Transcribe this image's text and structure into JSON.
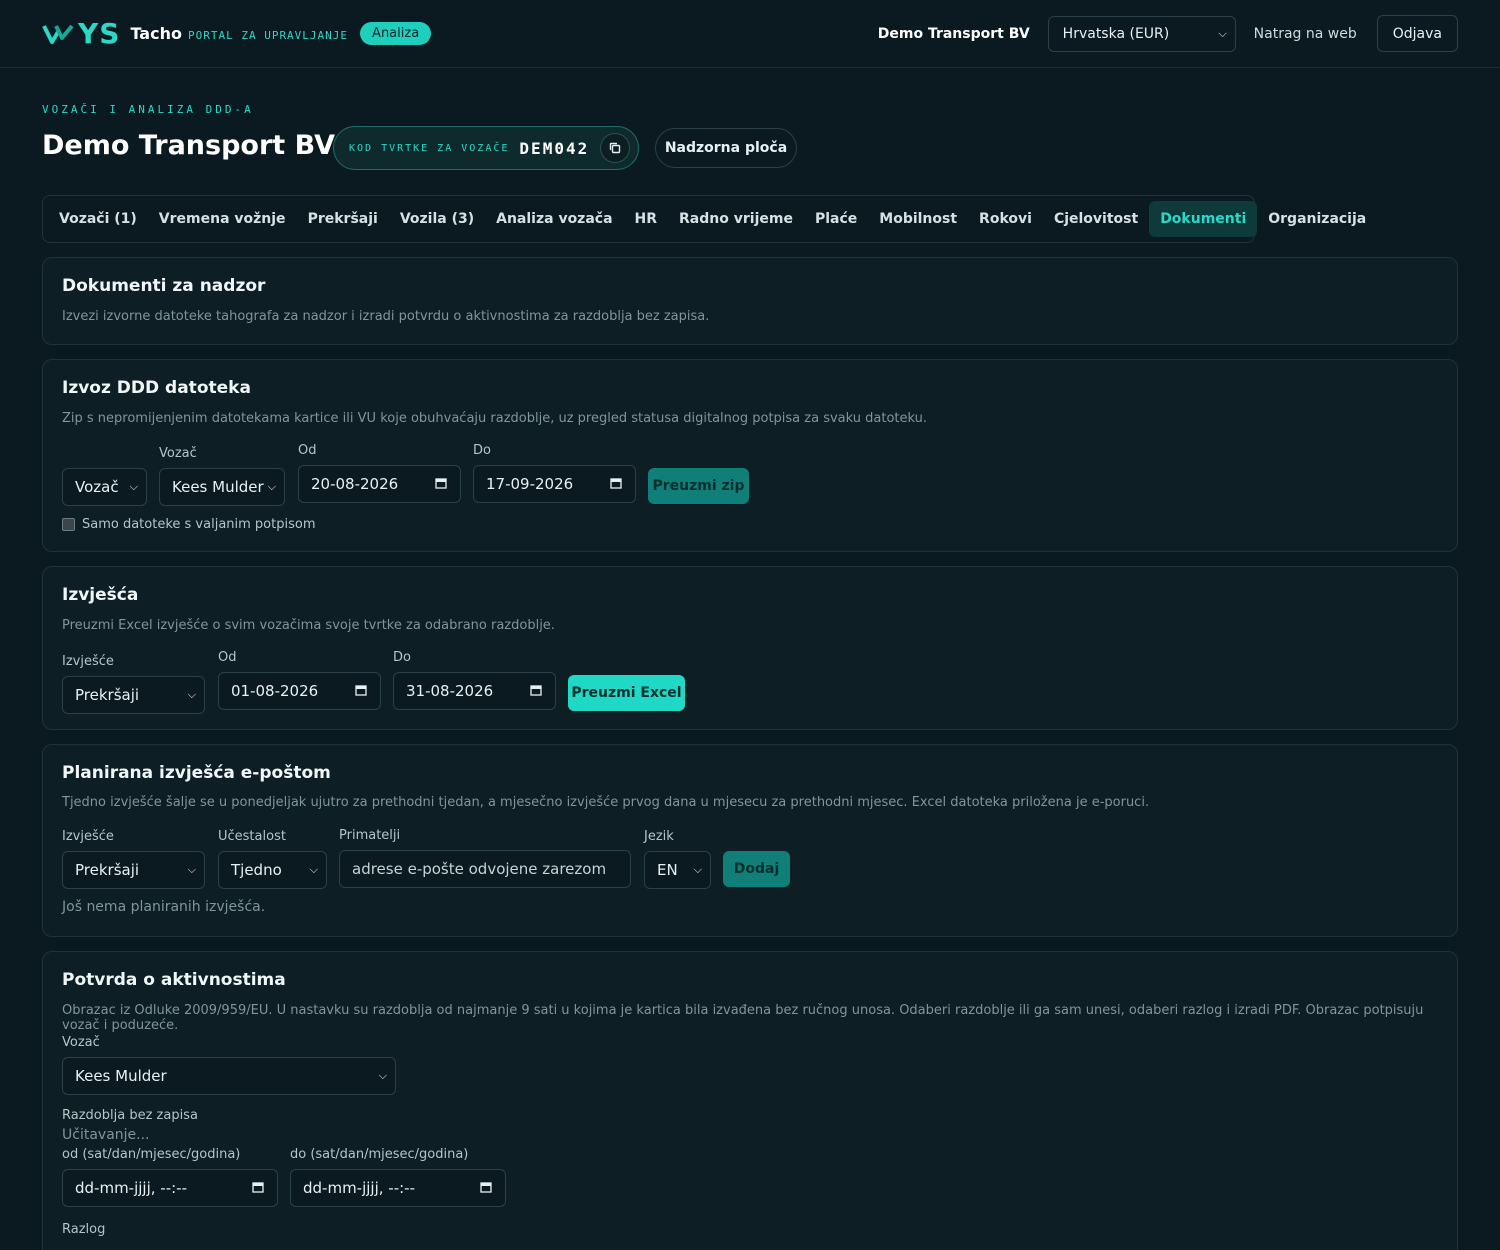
{
  "topbar": {
    "brand_ys": "YS",
    "brand_tacho": "Tacho",
    "brand_portal": "PORTAL ZA UPRAVLJANJE",
    "badge": "Analiza",
    "company": "Demo Transport BV",
    "region": "Hrvatska (EUR)",
    "back_link": "Natrag na web",
    "logout": "Odjava"
  },
  "header": {
    "eyebrow": "VOZAČI I ANALIZA DDD-A",
    "title": "Demo Transport BV",
    "code_label": "KOD TVRTKE ZA VOZAČE",
    "code_value": "DEM042",
    "dashboard_button": "Nadzorna ploča"
  },
  "tabs": [
    {
      "label": "Vozači (1)"
    },
    {
      "label": "Vremena vožnje"
    },
    {
      "label": "Prekršaji"
    },
    {
      "label": "Vozila (3)"
    },
    {
      "label": "Analiza vozača"
    },
    {
      "label": "HR"
    },
    {
      "label": "Radno vrijeme"
    },
    {
      "label": "Plaće"
    },
    {
      "label": "Mobilnost"
    },
    {
      "label": "Rokovi"
    },
    {
      "label": "Cjelovitost"
    },
    {
      "label": "Dokumenti",
      "active": true
    },
    {
      "label": "Organizacija"
    }
  ],
  "supervision": {
    "title": "Dokumenti za nadzor",
    "desc": "Izvezi izvorne datoteke tahografa za nadzor i izradi potvrdu o aktivnostima za razdoblja bez zapisa."
  },
  "ddd_export": {
    "title": "Izvoz DDD datoteka",
    "desc": "Zip s nepromijenjenim datotekama kartice ili VU koje obuhvaćaju razdoblje, uz pregled statusa digitalnog potpisa za svaku datoteku.",
    "type_select": "Vozač",
    "driver_label": "Vozač",
    "driver_select": "Kees Mulder",
    "from_label": "Od",
    "from_value": "20-08-2026",
    "to_label": "Do",
    "to_value": "17-09-2026",
    "download_button": "Preuzmi zip",
    "checkbox_label": "Samo datoteke s valjanim potpisom"
  },
  "reports": {
    "title": "Izvješća",
    "desc": "Preuzmi Excel izvješće o svim vozačima svoje tvrtke za odabrano razdoblje.",
    "report_label": "Izvješće",
    "report_select": "Prekršaji",
    "from_label": "Od",
    "from_value": "01-08-2026",
    "to_label": "Do",
    "to_value": "31-08-2026",
    "download_button": "Preuzmi Excel"
  },
  "scheduled": {
    "title": "Planirana izvješća e-poštom",
    "desc": "Tjedno izvješće šalje se u ponedjeljak ujutro za prethodni tjedan, a mjesečno izvješće prvog dana u mjesecu za prethodni mjesec. Excel datoteka priložena je e-poruci.",
    "report_label": "Izvješće",
    "report_select": "Prekršaji",
    "freq_label": "Učestalost",
    "freq_select": "Tjedno",
    "recipients_label": "Primatelji",
    "recipients_placeholder": "adrese e-pošte odvojene zarezom",
    "lang_label": "Jezik",
    "lang_select": "EN",
    "add_button": "Dodaj",
    "empty_text": "Još nema planiranih izvješća."
  },
  "activity": {
    "title": "Potvrda o aktivnostima",
    "desc": "Obrazac iz Odluke 2009/959/EU. U nastavku su razdoblja od najmanje 9 sati u kojima je kartica bila izvađena bez ručnog unosa. Odaberi razdoblje ili ga sam unesi, odaberi razlog i izradi PDF. Obrazac potpisuju vozač i poduzeće.",
    "driver_label": "Vozač",
    "driver_select": "Kees Mulder",
    "periods_label": "Razdoblja bez zapisa",
    "loading": "Učitavanje...",
    "from_label": "od (sat/dan/mjesec/godina)",
    "from_placeholder": "dd-mm-jjjj, --:--",
    "to_label": "do (sat/dan/mjesec/godina)",
    "to_placeholder": "dd-mm-jjjj, --:--",
    "reason_label": "Razlog"
  },
  "colors": {
    "accent": "#2ad9c8",
    "background": "#0b1a20",
    "card": "#0d1e24"
  }
}
